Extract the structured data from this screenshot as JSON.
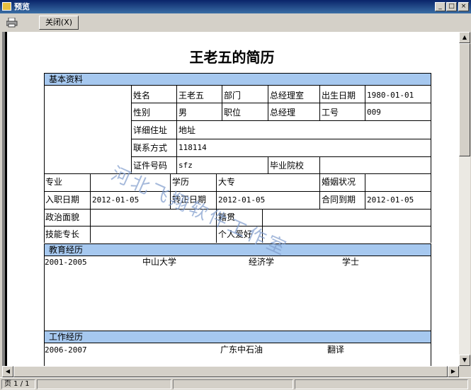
{
  "window": {
    "title": "预览",
    "min_glyph": "_",
    "max_glyph": "□",
    "close_glyph": "×"
  },
  "toolbar": {
    "close_label": "关闭(X)"
  },
  "status": {
    "page": "页 1 / 1"
  },
  "resume": {
    "title": "王老五的简历",
    "watermark": "河北飞翔软件工作室",
    "sections": {
      "basic": "基本资料",
      "education": "教育经历",
      "work": "工作经历"
    },
    "labels": {
      "name": "姓名",
      "department": "部门",
      "birth_date": "出生日期",
      "gender": "性别",
      "position": "职位",
      "employee_no": "工号",
      "address": "详细住址",
      "contact": "联系方式",
      "id_no": "证件号码",
      "school": "毕业院校",
      "major": "专业",
      "education": "学历",
      "marital": "婚姻状况",
      "join_date": "入职日期",
      "regular_date": "转正日期",
      "contract_end": "合同到期",
      "political": "政治面貌",
      "native_place": "籍贯",
      "skills": "技能专长",
      "hobbies": "个人爱好"
    },
    "values": {
      "name": "王老五",
      "department": "总经理室",
      "birth_date": "1980-01-01",
      "gender": "男",
      "position": "总经理",
      "employee_no": "009",
      "address": "地址",
      "contact": "118114",
      "id_no": "sfz",
      "major": "",
      "education": "大专",
      "marital": "",
      "join_date": "2012-01-05",
      "regular_date": "2012-01-05",
      "contract_end": "2012-01-05",
      "political": "",
      "native_place": "",
      "skills": "",
      "hobbies": ""
    },
    "education_rows": [
      {
        "period": "2001-2005",
        "school": "中山大学",
        "major": "经济学",
        "degree": "学士"
      }
    ],
    "work_rows": [
      {
        "period": "2006-2007",
        "company": "广东中石油",
        "position": "翻译"
      }
    ]
  }
}
